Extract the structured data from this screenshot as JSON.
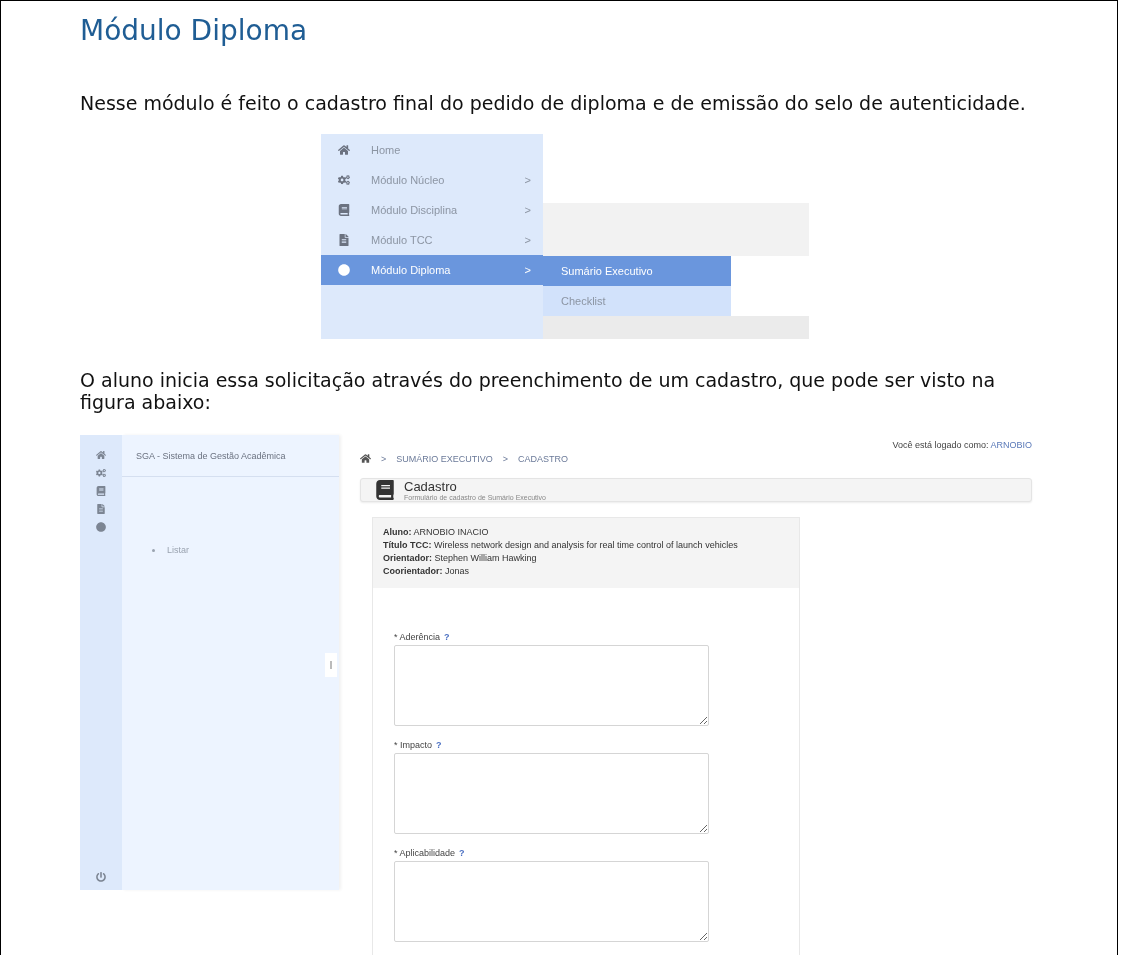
{
  "title": "Módulo Diploma",
  "intro": "Nesse módulo é feito o cadastro final do pedido de diploma e de emissão do selo de autenticidade.",
  "menu_figure": {
    "items": [
      {
        "label": "Home",
        "has_arrow": false,
        "selected": false
      },
      {
        "label": "Módulo Núcleo",
        "has_arrow": true,
        "selected": false
      },
      {
        "label": "Módulo Disciplina",
        "has_arrow": true,
        "selected": false
      },
      {
        "label": "Módulo TCC",
        "has_arrow": true,
        "selected": false
      },
      {
        "label": "Módulo Diploma",
        "has_arrow": true,
        "selected": true
      }
    ],
    "arrow": ">",
    "submenu": [
      {
        "label": "Sumário Executivo",
        "selected": true
      },
      {
        "label": "Checklist",
        "selected": false
      }
    ]
  },
  "second_paragraph": "O aluno inicia essa solicitação através do preenchimento de um cadastro, que pode ser visto na figura abaixo:",
  "app_figure": {
    "app_name": "SGA - Sistema de Gestão Acadêmica",
    "sidebar_items": [
      "Listar"
    ],
    "login_label": "Você está logado como:",
    "login_user": "ARNOBIO",
    "breadcrumb": [
      "SUMÁRIO EXECUTIVO",
      "CADASTRO"
    ],
    "breadcrumb_separator": ">",
    "page_title": "Cadastro",
    "page_subtitle": "Formulário de cadastro de Sumário Executivo",
    "info": [
      "**Aluno:** ARNOBIO INACIO",
      "**Título TCC:** Wireless network design and analysis for real time control of launch vehicles",
      "**Orientador:** Stephen William Hawking",
      "**Coorientador:** Jonas"
    ],
    "fields": [
      {
        "label": "* Aderência",
        "help": "?"
      },
      {
        "label": "* Impacto",
        "help": "?"
      },
      {
        "label": "* Aplicabilidade",
        "help": "?"
      }
    ]
  }
}
